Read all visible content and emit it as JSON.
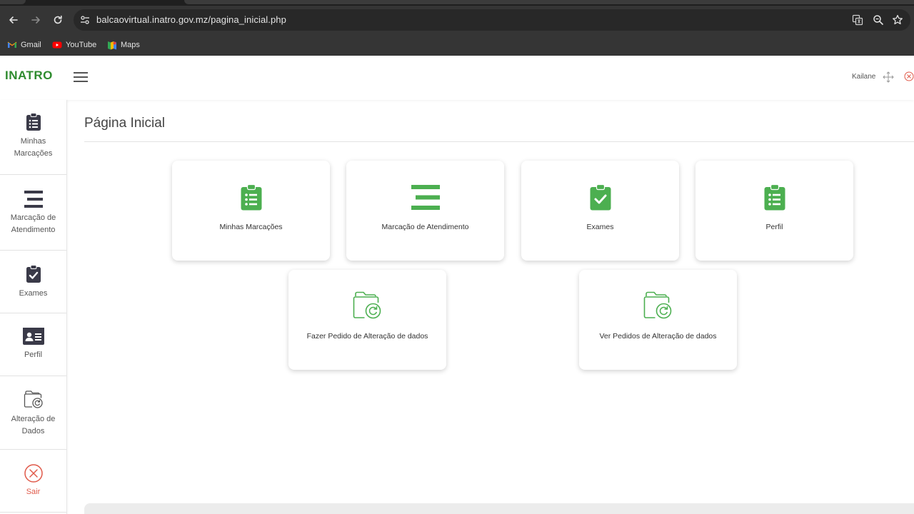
{
  "browser": {
    "url": "balcaovirtual.inatro.gov.mz/pagina_inicial.php",
    "bookmarks": [
      {
        "label": "Gmail",
        "icon": "gmail-icon"
      },
      {
        "label": "YouTube",
        "icon": "youtube-icon"
      },
      {
        "label": "Maps",
        "icon": "maps-icon"
      }
    ]
  },
  "header": {
    "logo": "INATRO",
    "user_name": "Kailane"
  },
  "sidebar": {
    "items": [
      {
        "label_line1": "Minhas",
        "label_line2": "Marcações",
        "icon": "clipboard-list-icon"
      },
      {
        "label_line1": "Marcação de",
        "label_line2": "Atendimento",
        "icon": "bars-icon"
      },
      {
        "label_line1": "Exames",
        "label_line2": "",
        "icon": "clipboard-check-icon"
      },
      {
        "label_line1": "Perfil",
        "label_line2": "",
        "icon": "id-card-icon"
      },
      {
        "label_line1": "Alteração de",
        "label_line2": "Dados",
        "icon": "folder-refresh-icon"
      },
      {
        "label_line1": "Sair",
        "label_line2": "",
        "icon": "circle-x-icon"
      }
    ]
  },
  "main": {
    "title": "Página Inicial",
    "cards": [
      {
        "label": "Minhas Marcações",
        "icon": "clipboard-list-icon"
      },
      {
        "label": "Marcação de Atendimento",
        "icon": "bars-icon"
      },
      {
        "label": "Exames",
        "icon": "clipboard-check-icon"
      },
      {
        "label": "Perfil",
        "icon": "clipboard-list-icon"
      },
      {
        "label": "Fazer Pedido de Alteração de dados",
        "icon": "folder-refresh-icon"
      },
      {
        "label": "Ver Pedidos de Alteração de dados",
        "icon": "folder-refresh-icon"
      }
    ]
  },
  "colors": {
    "brand_green": "#2e8b2e",
    "icon_green": "#4caf50",
    "sidebar_icon": "#3a3a48",
    "exit_red": "#e05a4a"
  }
}
